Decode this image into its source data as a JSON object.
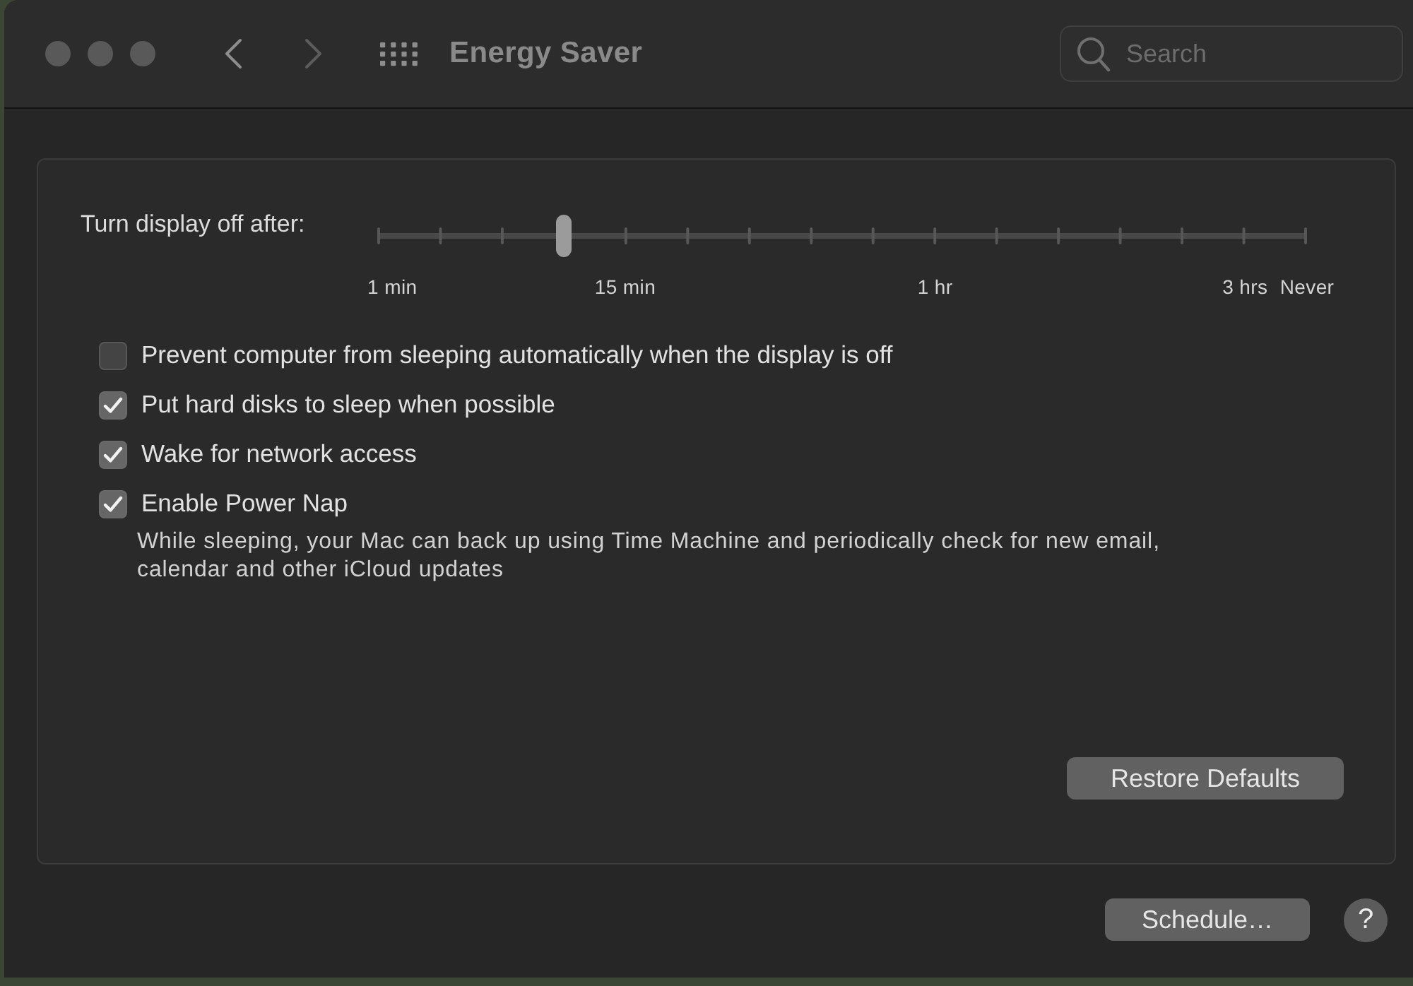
{
  "window": {
    "title": "Energy Saver"
  },
  "navigation": {
    "back": {
      "disabled": false
    },
    "forward": {
      "disabled": true
    }
  },
  "search": {
    "placeholder": "Search"
  },
  "display_sleep": {
    "label": "Turn display off after:",
    "level": 0.2,
    "tick_labels": [
      "1 min",
      "15 min",
      "1 hr",
      "3 hrs",
      "Never"
    ]
  },
  "options": [
    {
      "label": "Prevent computer from sleeping automatically when the display is off",
      "checked": false
    },
    {
      "label": "Put hard disks to sleep when possible",
      "checked": true
    },
    {
      "label": "Wake for network access",
      "checked": true
    },
    {
      "label": "Enable Power Nap",
      "checked": true,
      "description": "While sleeping, your Mac can back up using Time Machine and periodically check for new email, calendar and other iCloud updates"
    }
  ],
  "restore_defaults": {
    "label": "Restore Defaults"
  },
  "footer": {
    "schedule": {
      "label": "Schedule…"
    },
    "help": {
      "label": "?"
    }
  }
}
